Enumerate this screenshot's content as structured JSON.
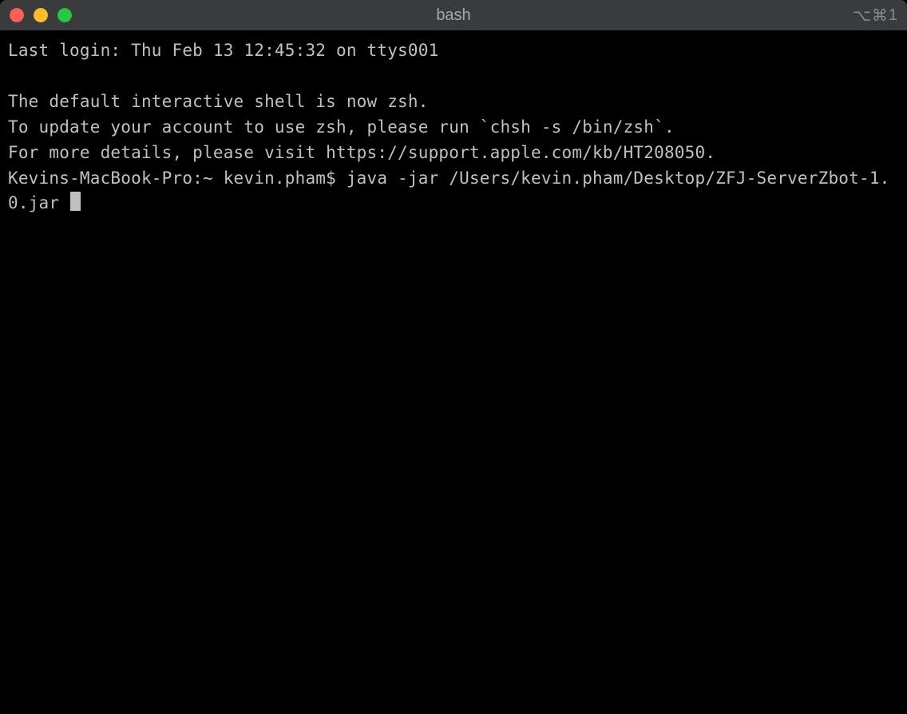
{
  "titlebar": {
    "title": "bash",
    "shortcut_option": "⌥",
    "shortcut_command": "⌘",
    "shortcut_number": "1"
  },
  "terminal": {
    "last_login": "Last login: Thu Feb 13 12:45:32 on ttys001",
    "blank_line": "",
    "zsh_notice_line1": "The default interactive shell is now zsh.",
    "zsh_notice_line2": "To update your account to use zsh, please run `chsh -s /bin/zsh`.",
    "zsh_notice_line3": "For more details, please visit https://support.apple.com/kb/HT208050.",
    "prompt": "Kevins-MacBook-Pro:~ kevin.pham$ ",
    "command": "java -jar /Users/kevin.pham/Desktop/ZFJ-ServerZbot-1.0.jar "
  }
}
